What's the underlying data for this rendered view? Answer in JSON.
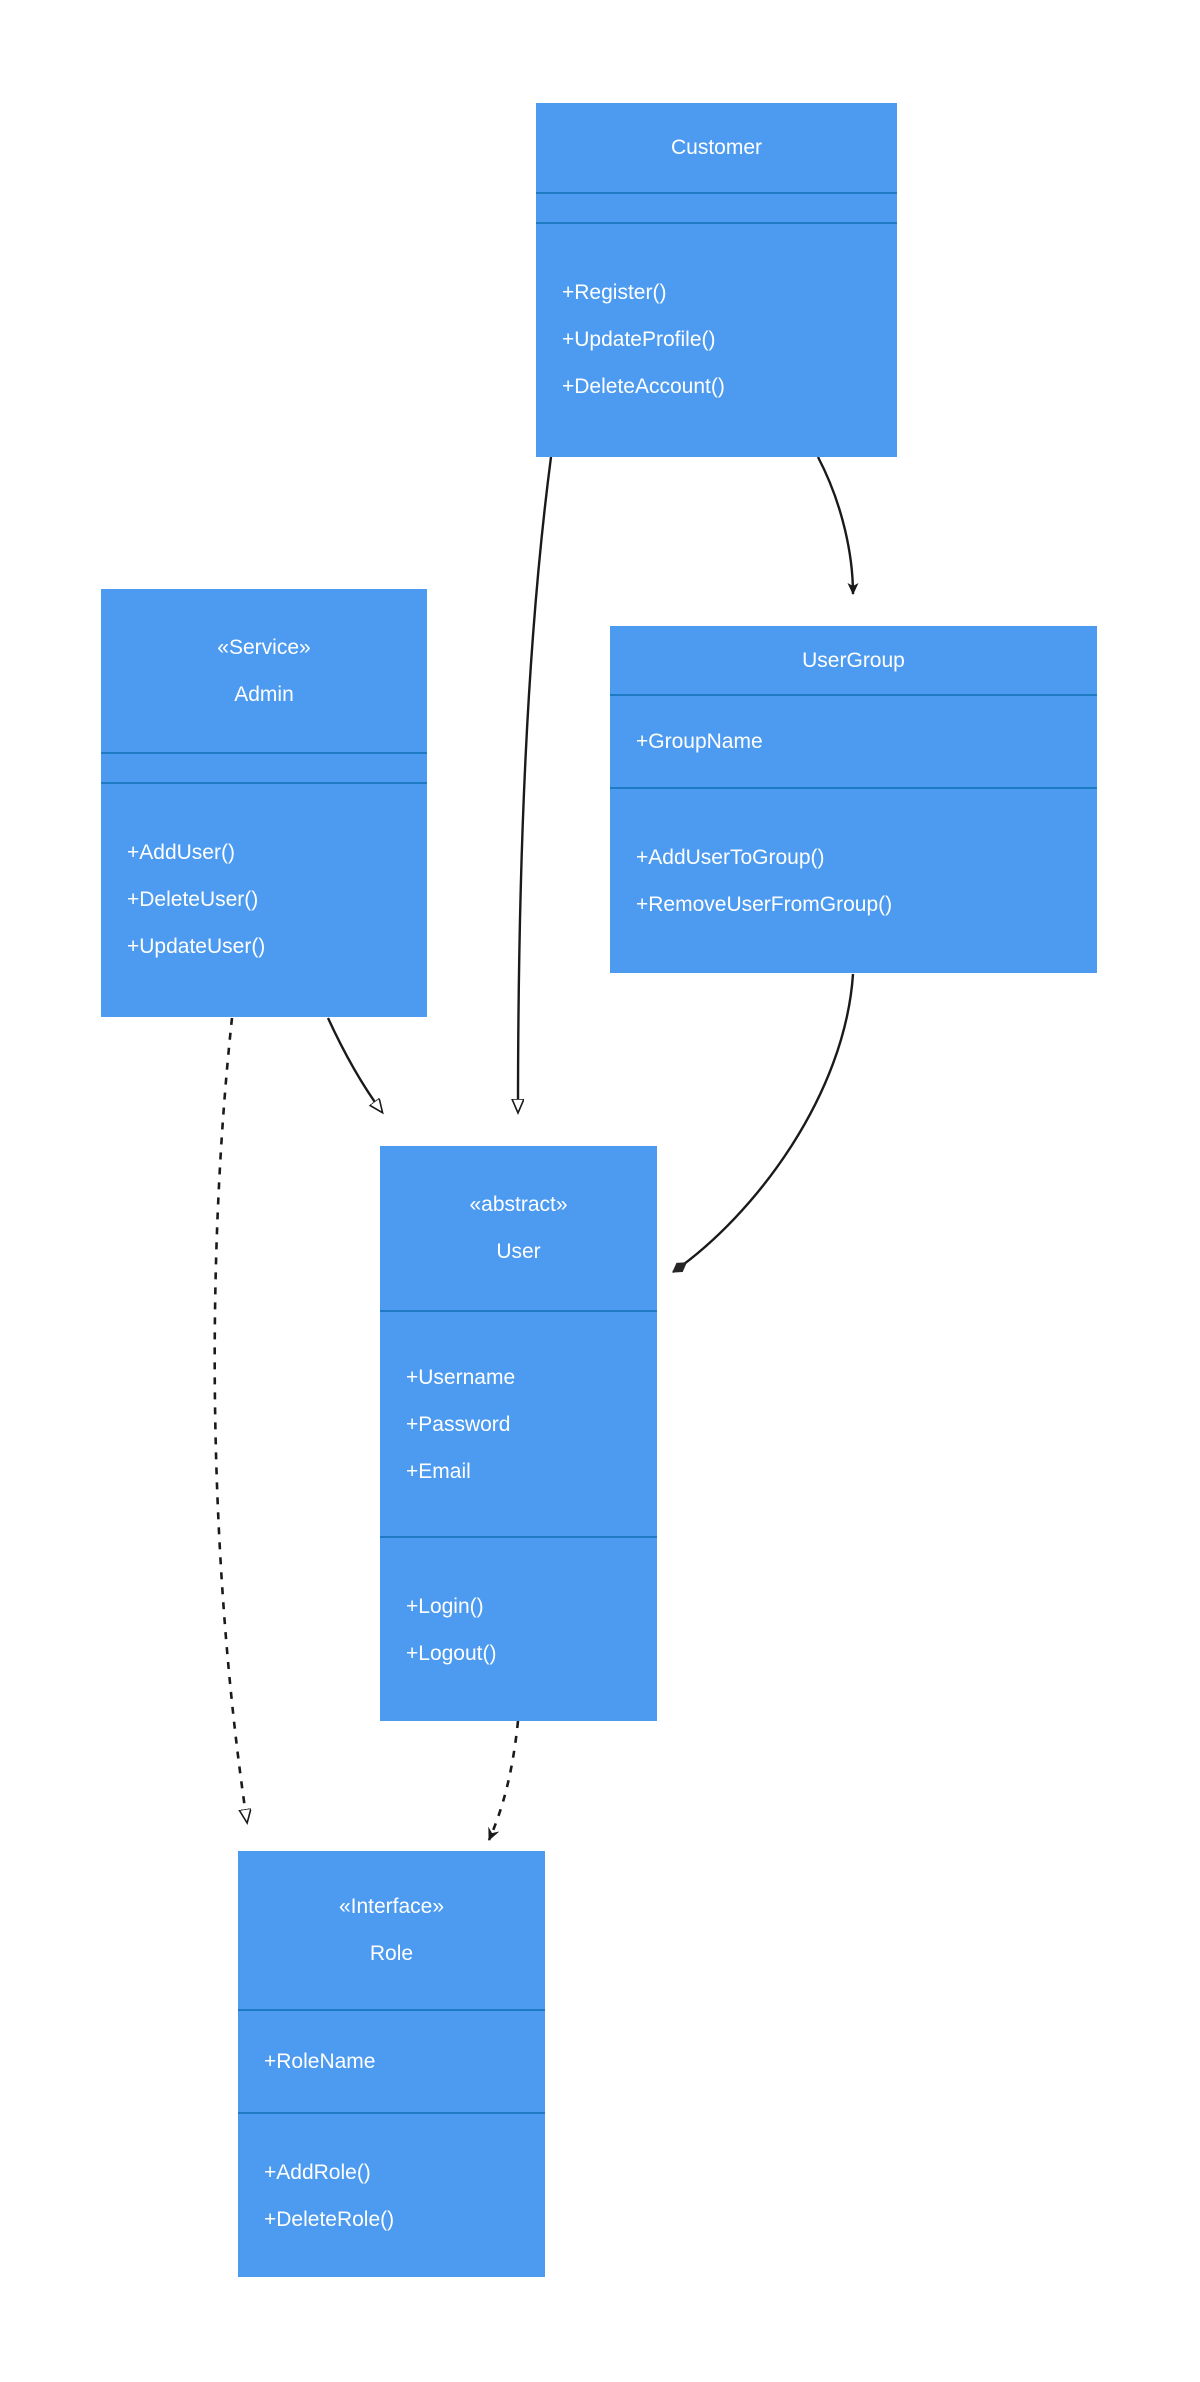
{
  "diagram": {
    "kind": "uml-class-diagram",
    "colors": {
      "class_fill": "#4d9bf0",
      "compartment_divider": "#1f7ac4",
      "edge_stroke": "#1a1a1a",
      "text": "#ffffff",
      "background": "#ffffff"
    }
  },
  "classes": [
    {
      "id": "customer",
      "name": "Customer",
      "stereotype": "",
      "attributes": [],
      "methods": [
        "+Register()",
        "+UpdateProfile()",
        "+DeleteAccount()"
      ]
    },
    {
      "id": "admin",
      "name": "Admin",
      "stereotype": "«Service»",
      "attributes": [],
      "methods": [
        "+AddUser()",
        "+DeleteUser()",
        "+UpdateUser()"
      ]
    },
    {
      "id": "usergroup",
      "name": "UserGroup",
      "stereotype": "",
      "attributes": [
        "+GroupName"
      ],
      "methods": [
        "+AddUserToGroup()",
        "+RemoveUserFromGroup()"
      ]
    },
    {
      "id": "user",
      "name": "User",
      "stereotype": "«abstract»",
      "attributes": [
        "+Username",
        "+Password",
        "+Email"
      ],
      "methods": [
        "+Login()",
        "+Logout()"
      ]
    },
    {
      "id": "role",
      "name": "Role",
      "stereotype": "«Interface»",
      "attributes": [
        "+RoleName"
      ],
      "methods": [
        "+AddRole()",
        "+DeleteRole()"
      ]
    }
  ],
  "relationships": [
    {
      "id": "customer-user",
      "from": "Customer",
      "to": "User",
      "type": "generalization",
      "line": "solid",
      "arrowhead": "hollow-triangle"
    },
    {
      "id": "customer-usergroup",
      "from": "Customer",
      "to": "UserGroup",
      "type": "association",
      "line": "solid",
      "arrowhead": "solid-arrow"
    },
    {
      "id": "admin-user",
      "from": "Admin",
      "to": "User",
      "type": "generalization",
      "line": "solid",
      "arrowhead": "hollow-triangle"
    },
    {
      "id": "admin-role",
      "from": "Admin",
      "to": "Role",
      "type": "realization",
      "line": "dashed",
      "arrowhead": "hollow-triangle"
    },
    {
      "id": "usergroup-user",
      "from": "UserGroup",
      "to": "User",
      "type": "composition",
      "line": "solid",
      "arrowhead": "filled-diamond"
    },
    {
      "id": "user-role",
      "from": "User",
      "to": "Role",
      "type": "dependency",
      "line": "dashed",
      "arrowhead": "open-arrow"
    }
  ]
}
